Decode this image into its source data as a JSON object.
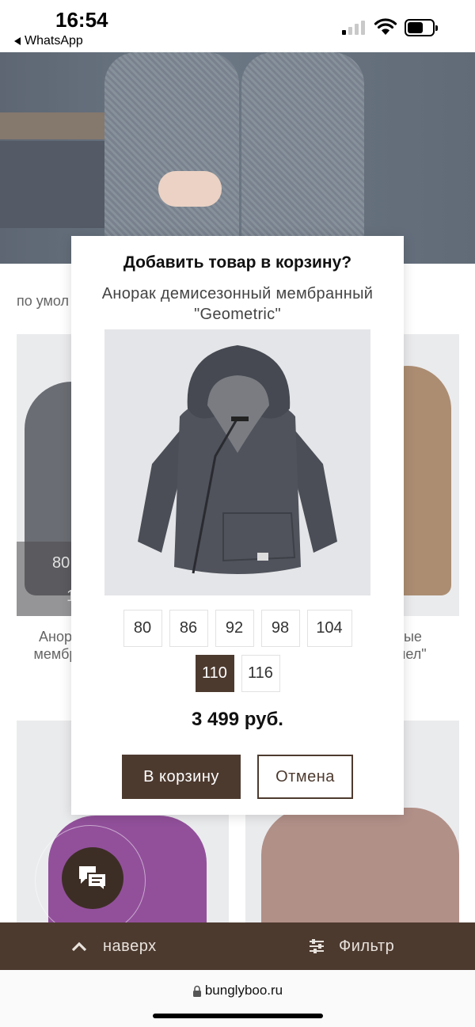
{
  "status_bar": {
    "time": "16:54",
    "back_app": "WhatsApp"
  },
  "background": {
    "sort_text": "по умол",
    "card1_size_partial": "80",
    "card1_size_partial_2": "1",
    "card1_label": "Анор\nмембр",
    "card2_label": "ные\nмел\""
  },
  "modal": {
    "title": "Добавить товар в корзину?",
    "product_name": "Анорак демисезонный мембранный \"Geometric\"",
    "sizes": [
      "80",
      "86",
      "92",
      "98",
      "104",
      "110",
      "116"
    ],
    "selected_size": "110",
    "price": "3 499 руб.",
    "add_button": "В корзину",
    "cancel_button": "Отмена"
  },
  "bottom_bar": {
    "up_label": "наверх",
    "filter_label": "Фильтр"
  },
  "browser": {
    "url": "bunglyboo.ru"
  },
  "colors": {
    "brand": "#4d3a2f",
    "selected_size_bg": "#4d3a2f"
  },
  "icons": {
    "chat": "chat-bubbles-icon",
    "up": "chevron-up-icon",
    "filter": "filter-sliders-icon",
    "lock": "lock-icon"
  }
}
